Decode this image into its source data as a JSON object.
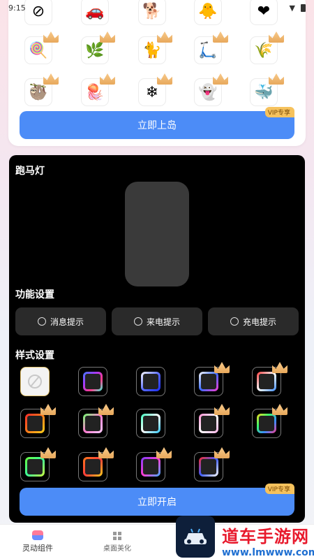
{
  "status_bar": {
    "time": "9:15"
  },
  "colors": {
    "accent": "#4c8cf7",
    "vip": "#f6c25d",
    "dark_card": "#000000"
  },
  "stickers": [
    {
      "icon": "blocked-icon",
      "glyph": "⊘"
    },
    {
      "icon": "car-icon",
      "glyph": "🚗"
    },
    {
      "icon": "corgi-icon",
      "glyph": "🐕"
    },
    {
      "icon": "chick-icon",
      "glyph": "🐥"
    },
    {
      "icon": "heart-icon",
      "glyph": "❤"
    },
    {
      "icon": "lollipop-icon",
      "glyph": "🍭"
    },
    {
      "icon": "grass-icon",
      "glyph": "🌿"
    },
    {
      "icon": "black-cat-icon",
      "glyph": "🐈"
    },
    {
      "icon": "scooter-rider-icon",
      "glyph": "🛴"
    },
    {
      "icon": "willow-icon",
      "glyph": "🌾"
    },
    {
      "icon": "sloth-icon",
      "glyph": "🦥"
    },
    {
      "icon": "jellyfish-icon",
      "glyph": "🪼"
    },
    {
      "icon": "snowflake-icon",
      "glyph": "❄"
    },
    {
      "icon": "ghost-icon",
      "glyph": "👻"
    },
    {
      "icon": "whale-icon",
      "glyph": "🐳"
    }
  ],
  "top_card": {
    "action_label": "立即上岛",
    "vip_label": "VIP专享"
  },
  "marquee": {
    "title": "跑马灯",
    "function_title": "功能设置",
    "functions": [
      "消息提示",
      "来电提示",
      "充电提示"
    ],
    "style_title": "样式设置",
    "action_label": "立即开启",
    "vip_label": "VIP专享"
  },
  "styles": [
    {
      "name": "none",
      "premium": false
    },
    {
      "name": "rainbow-blue",
      "premium": false,
      "gradient": "linear-gradient(135deg,#3b7bff,#a23bff,#ff3b8b,#3bffd9)"
    },
    {
      "name": "blue-white",
      "premium": false,
      "gradient": "linear-gradient(135deg,#ffffff,#5a6cff,#1a2bff)"
    },
    {
      "name": "white-blue",
      "premium": true,
      "gradient": "linear-gradient(135deg,#ffffff,#3b6bff,#ff3bd0)"
    },
    {
      "name": "red-orange",
      "premium": true,
      "gradient": "linear-gradient(135deg,#ff3b3b,#ffffff,#3b8bff)"
    },
    {
      "name": "red-yellow",
      "premium": true,
      "gradient": "linear-gradient(135deg,#ff2a2a,#ff7a1a,#ffd21a)"
    },
    {
      "name": "green-pink",
      "premium": true,
      "gradient": "linear-gradient(135deg,#6bff6b,#ff7ad0,#ffd0ff)"
    },
    {
      "name": "teal-white",
      "premium": false,
      "gradient": "linear-gradient(135deg,#3bffc0,#ffffff,#2ac7ff)"
    },
    {
      "name": "pink-white",
      "premium": true,
      "gradient": "linear-gradient(135deg,#ff8ad0,#ffffff,#ffb3e6)"
    },
    {
      "name": "multicolor",
      "premium": true,
      "gradient": "linear-gradient(135deg,#ffd21a,#3bff6b,#3b8bff,#ff3b8b)"
    },
    {
      "name": "neon-green",
      "premium": true,
      "gradient": "linear-gradient(135deg,#6bff3b,#3bff9b,#d0ff3b)"
    },
    {
      "name": "orange-red",
      "premium": true,
      "gradient": "linear-gradient(135deg,#ff7a1a,#ff3b3b,#ffd21a)"
    },
    {
      "name": "purple-gradient",
      "premium": true,
      "gradient": "linear-gradient(135deg,#7a3bff,#ff3bd0,#3bb0ff)"
    },
    {
      "name": "red-blue",
      "premium": true,
      "gradient": "linear-gradient(135deg,#ff2a2a,#3b5bff,#ffffff)"
    }
  ],
  "bottom_nav": {
    "items": [
      "灵动组件",
      "桌面美化"
    ]
  },
  "watermark": {
    "title": "道车手游网",
    "url": "www.lmwww.com"
  }
}
